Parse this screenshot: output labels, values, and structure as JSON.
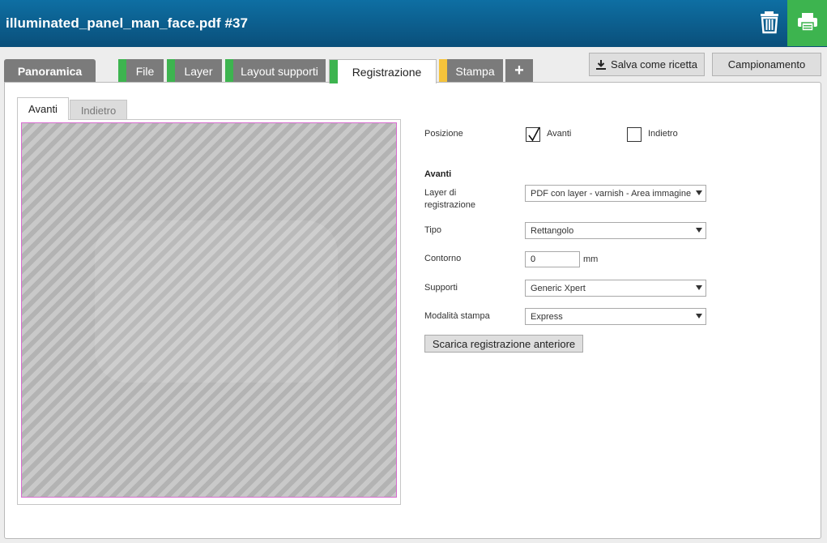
{
  "header": {
    "title": "illuminated_panel_man_face.pdf #37",
    "icons": {
      "delete": "trash-icon",
      "print": "printer-icon"
    },
    "print_color": "#3db44f"
  },
  "tabs": [
    {
      "label": "Panoramica",
      "stripe": ""
    },
    {
      "label": "File",
      "stripe": "#3db44f"
    },
    {
      "label": "Layer",
      "stripe": "#3db44f"
    },
    {
      "label": "Layout supporti",
      "stripe": "#3db44f"
    },
    {
      "label": "Registrazione",
      "stripe": "#3db44f"
    },
    {
      "label": "Stampa",
      "stripe": "#f5c33b"
    },
    {
      "label": "+",
      "stripe": ""
    }
  ],
  "active_tab": "Registrazione",
  "toolbar": {
    "save_recipe": "Salva come ricetta",
    "sampling": "Campionamento"
  },
  "subtabs": {
    "front": "Avanti",
    "back": "Indietro",
    "active": "Avanti"
  },
  "form": {
    "position_label": "Posizione",
    "front_option": {
      "label": "Avanti",
      "checked": true
    },
    "back_option": {
      "label": "Indietro",
      "checked": false
    },
    "section_title": "Avanti",
    "layer_label": "Layer di registrazione",
    "layer_value": "PDF con layer - varnish - Area immagine v",
    "type_label": "Tipo",
    "type_value": "Rettangolo",
    "contour_label": "Contorno",
    "contour_value": "0",
    "contour_unit": "mm",
    "media_label": "Supporti",
    "media_value": "Generic Xpert",
    "print_mode_label": "Modalità stampa",
    "print_mode_value": "Express",
    "download_button": "Scarica registrazione anteriore"
  }
}
